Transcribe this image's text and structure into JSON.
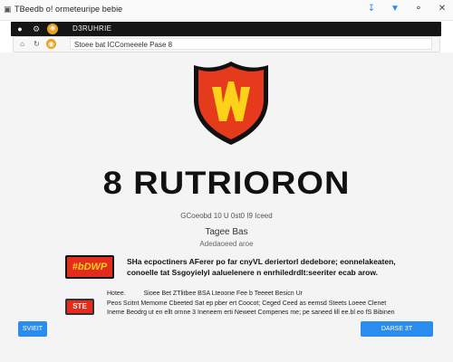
{
  "window": {
    "title": "TBeedb o! ormeteuripe bebie",
    "icons": [
      "app-icon",
      "download-icon",
      "filter-icon",
      "help-icon",
      "close-icon"
    ]
  },
  "toolbar": {
    "label": "D3RUHRIE"
  },
  "addressbar": {
    "url": "Stoee bat ICComeeele Pase 8"
  },
  "brand": {
    "name": "8 RUTRIORON",
    "subtitle1": "GCoeobd 10 U 0st0 I9 Iceed",
    "subtitle2": "Tagee Bas",
    "subtitle3": "Adedaoeed aroe"
  },
  "promo": {
    "badge": "#bDWP",
    "lines": [
      "SHa ecpoctiners AFerer po far cnyVL deriertorl dedebore; eonnelakeaten,",
      "conoelle tat Ssgoyielyl aaluelenere n enrhiledrdlt:seeriter ecab arow."
    ]
  },
  "notes": {
    "badge": "STE",
    "head_left": "Hotee.",
    "head_right": "Sioee Bet ZTlitbee BSA Lteoone Fee b Teeeet Besicn Ur",
    "lines": [
      "Peos Scitnt Memome Cbeeted Sat ep pber ert Coocot; Ceged Ceed as eemsd Steets Loeee Clenet",
      "Ineme Beodrg ut en ellt ornne 3 Ineneem erti Neweet Compenes me; pe saneed lill ee.bl eo fS Bibinen"
    ]
  },
  "actions": {
    "left": "SVIEIT",
    "right": "DARSE 3T"
  },
  "colors": {
    "accent": "#2b8cf0",
    "badge_red": "#e32c1c",
    "badge_text": "#ffd21a",
    "toolbar": "#151515"
  }
}
